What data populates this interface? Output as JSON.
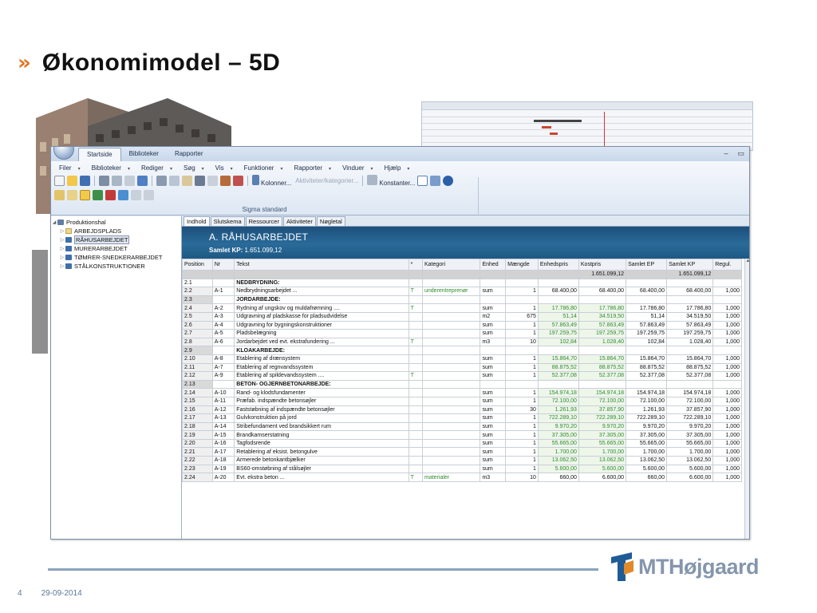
{
  "slide": {
    "title": "Økonomimodel – 5D",
    "page_number": "4",
    "date": "29-09-2014",
    "logo_text": "MTHøjgaard"
  },
  "window": {
    "tabs": [
      "Startside",
      "Biblioteker",
      "Rapporter"
    ],
    "active_tab": "Startside",
    "menu": [
      "Filer",
      "Biblioteker",
      "Rediger",
      "Søg",
      "Vis",
      "Funktioner",
      "Rapporter",
      "Vinduer",
      "Hjælp"
    ],
    "toolbar_labels": {
      "kolonner": "Kolonner...",
      "aktiviteter": "Aktiviteter/kategorier...",
      "konstanter": "Konstanter..."
    },
    "group_label": "Sigma standard"
  },
  "tree": {
    "root": "Produktionshal",
    "items": [
      "ARBEJDSPLADS",
      "RÅHUSARBEJDET",
      "MURERARBEJDET",
      "TØMRER-SNEDKERARBEJDET",
      "STÅLKONSTRUKTIONER"
    ],
    "selected": "RÅHUSARBEJDET"
  },
  "doc_tabs": [
    "Indhold",
    "Slutskema",
    "Ressourcer",
    "Aktiviteter",
    "Nøgletal"
  ],
  "banner": {
    "title": "A. RÅHUSARBEJDET",
    "samlet_label": "Samlet KP:",
    "samlet_value": "1.651.099,12"
  },
  "table": {
    "columns": [
      "Position",
      "Nr",
      "Tekst",
      "*",
      "Kategori",
      "Enhed",
      "Mængde",
      "Enhedspris",
      "Kostpris",
      "Samlet EP",
      "Samlet KP",
      "Regul."
    ],
    "totals": {
      "kostpris": "1.651.099,12",
      "samlet_kp": "1.651.099,12"
    },
    "rows": [
      {
        "pos": "2.1",
        "nr": "",
        "tekst": "NEDBRYDNING:",
        "star": "",
        "kat": "",
        "enhed": "",
        "maengde": "",
        "ep": "",
        "kp": "",
        "sep": "",
        "skp": "",
        "regul": "",
        "header": true
      },
      {
        "pos": "2.2",
        "nr": "A-1",
        "tekst": "Nedbrydningsarbejdet ...",
        "star": "T",
        "kat": "underentreprenør",
        "enhed": "sum",
        "maengde": "1",
        "ep": "68.400,00",
        "kp": "68.400,00",
        "sep": "68.400,00",
        "skp": "68.400,00",
        "regul": "1,000"
      },
      {
        "pos": "2.3",
        "nr": "",
        "tekst": "JORDARBEJDE:",
        "star": "",
        "kat": "",
        "enhed": "",
        "maengde": "",
        "ep": "",
        "kp": "",
        "sep": "",
        "skp": "",
        "regul": "",
        "header": true
      },
      {
        "pos": "2.4",
        "nr": "A-2",
        "tekst": "Rydning af ungskov og muldafrømning ....",
        "star": "T",
        "kat": "",
        "enhed": "sum",
        "maengde": "1",
        "ep": "17.786,80",
        "kp": "17.786,80",
        "sep": "17.786,80",
        "skp": "17.786,80",
        "regul": "1,000",
        "green": true
      },
      {
        "pos": "2.5",
        "nr": "A-3",
        "tekst": "Udgravning af pladskasse for pladsudvidelse",
        "star": "",
        "kat": "",
        "enhed": "m2",
        "maengde": "675",
        "ep": "51,14",
        "kp": "34.519,50",
        "sep": "51,14",
        "skp": "34.519,50",
        "regul": "1,000",
        "green": true
      },
      {
        "pos": "2.6",
        "nr": "A-4",
        "tekst": "Udgravning for bygningskonstruktioner",
        "star": "",
        "kat": "",
        "enhed": "sum",
        "maengde": "1",
        "ep": "57.863,49",
        "kp": "57.863,49",
        "sep": "57.863,49",
        "skp": "57.863,49",
        "regul": "1,000",
        "green": true
      },
      {
        "pos": "2.7",
        "nr": "A-5",
        "tekst": "Pladsbelægning",
        "star": "",
        "kat": "",
        "enhed": "sum",
        "maengde": "1",
        "ep": "197.259,75",
        "kp": "197.259,75",
        "sep": "197.259,75",
        "skp": "197.259,75",
        "regul": "1,000",
        "green": true
      },
      {
        "pos": "2.8",
        "nr": "A-6",
        "tekst": "Jordarbejdet ved evt. ekstrafundering ...",
        "star": "T",
        "kat": "",
        "enhed": "m3",
        "maengde": "10",
        "ep": "102,84",
        "kp": "1.028,40",
        "sep": "102,84",
        "skp": "1.028,40",
        "regul": "1,000",
        "green": true
      },
      {
        "pos": "2.9",
        "nr": "",
        "tekst": "KLOAKARBEJDE:",
        "star": "",
        "kat": "",
        "enhed": "",
        "maengde": "",
        "ep": "",
        "kp": "",
        "sep": "",
        "skp": "",
        "regul": "",
        "header": true
      },
      {
        "pos": "2.10",
        "nr": "A-8",
        "tekst": "Etablering af drænsystem",
        "star": "",
        "kat": "",
        "enhed": "sum",
        "maengde": "1",
        "ep": "15.864,70",
        "kp": "15.864,70",
        "sep": "15.864,70",
        "skp": "15.864,70",
        "regul": "1,000",
        "green": true
      },
      {
        "pos": "2.11",
        "nr": "A-7",
        "tekst": "Etablering af regnvandssystem",
        "star": "",
        "kat": "",
        "enhed": "sum",
        "maengde": "1",
        "ep": "88.875,52",
        "kp": "88.875,52",
        "sep": "88.875,52",
        "skp": "88.875,52",
        "regul": "1,000",
        "green": true
      },
      {
        "pos": "2.12",
        "nr": "A-9",
        "tekst": "Etablering af spildevandssystem ....",
        "star": "T",
        "kat": "",
        "enhed": "sum",
        "maengde": "1",
        "ep": "52.377,08",
        "kp": "52.377,08",
        "sep": "52.377,08",
        "skp": "52.377,08",
        "regul": "1,000",
        "green": true
      },
      {
        "pos": "2.13",
        "nr": "",
        "tekst": "BETON- OGJERNBETONARBEJDE:",
        "star": "",
        "kat": "",
        "enhed": "",
        "maengde": "",
        "ep": "",
        "kp": "",
        "sep": "",
        "skp": "",
        "regul": "",
        "header": true
      },
      {
        "pos": "2.14",
        "nr": "A-10",
        "tekst": "Rand- og klodsfundamenter",
        "star": "",
        "kat": "",
        "enhed": "sum",
        "maengde": "1",
        "ep": "154.974,18",
        "kp": "154.974,18",
        "sep": "154.974,18",
        "skp": "154.974,18",
        "regul": "1,000",
        "green": true
      },
      {
        "pos": "2.15",
        "nr": "A-11",
        "tekst": "Præfab. indspændte betonsøjler",
        "star": "",
        "kat": "",
        "enhed": "sum",
        "maengde": "1",
        "ep": "72.100,00",
        "kp": "72.100,00",
        "sep": "72.100,00",
        "skp": "72.100,00",
        "regul": "1,000",
        "green": true
      },
      {
        "pos": "2.16",
        "nr": "A-12",
        "tekst": "Faststøbning af indspændte betonsøjler",
        "star": "",
        "kat": "",
        "enhed": "sum",
        "maengde": "30",
        "ep": "1.261,93",
        "kp": "37.857,90",
        "sep": "1.261,93",
        "skp": "37.857,90",
        "regul": "1,000",
        "green": true
      },
      {
        "pos": "2.17",
        "nr": "A-13",
        "tekst": "Gulvkonstruktion på jord",
        "star": "",
        "kat": "",
        "enhed": "sum",
        "maengde": "1",
        "ep": "722.289,10",
        "kp": "722.289,10",
        "sep": "722.289,10",
        "skp": "722.289,10",
        "regul": "1,000",
        "green": true
      },
      {
        "pos": "2.18",
        "nr": "A-14",
        "tekst": "Stribefundament ved brandsikkert rum",
        "star": "",
        "kat": "",
        "enhed": "sum",
        "maengde": "1",
        "ep": "9.970,20",
        "kp": "9.970,20",
        "sep": "9.970,20",
        "skp": "9.970,20",
        "regul": "1,000",
        "green": true
      },
      {
        "pos": "2.19",
        "nr": "A-15",
        "tekst": "Brandkamserstatning",
        "star": "",
        "kat": "",
        "enhed": "sum",
        "maengde": "1",
        "ep": "37.305,00",
        "kp": "37.305,00",
        "sep": "37.305,00",
        "skp": "37.305,00",
        "regul": "1,000",
        "green": true
      },
      {
        "pos": "2.20",
        "nr": "A-16",
        "tekst": "Tagfodsrende",
        "star": "",
        "kat": "",
        "enhed": "sum",
        "maengde": "1",
        "ep": "55.665,00",
        "kp": "55.665,00",
        "sep": "55.665,00",
        "skp": "55.665,00",
        "regul": "1,000",
        "green": true
      },
      {
        "pos": "2.21",
        "nr": "A-17",
        "tekst": "Retablering af eksist. betongulve",
        "star": "",
        "kat": "",
        "enhed": "sum",
        "maengde": "1",
        "ep": "1.700,00",
        "kp": "1.700,00",
        "sep": "1.700,00",
        "skp": "1.700,00",
        "regul": "1,000",
        "green": true
      },
      {
        "pos": "2.22",
        "nr": "A-18",
        "tekst": "Armerede betonkantbjælker",
        "star": "",
        "kat": "",
        "enhed": "sum",
        "maengde": "1",
        "ep": "13.062,50",
        "kp": "13.062,50",
        "sep": "13.062,50",
        "skp": "13.062,50",
        "regul": "1,000",
        "green": true
      },
      {
        "pos": "2.23",
        "nr": "A-19",
        "tekst": "BS60-omstøbning af stålsøjler",
        "star": "",
        "kat": "",
        "enhed": "sum",
        "maengde": "1",
        "ep": "5.600,00",
        "kp": "5.600,00",
        "sep": "5.600,00",
        "skp": "5.600,00",
        "regul": "1,000",
        "green": true
      },
      {
        "pos": "2.24",
        "nr": "A-20",
        "tekst": "Evt. ekstra beton ...",
        "star": "T",
        "kat": "materialer",
        "enhed": "m3",
        "maengde": "10",
        "ep": "660,00",
        "kp": "6.600,00",
        "sep": "660,00",
        "skp": "6.600,00",
        "regul": "1,000"
      }
    ]
  },
  "colors": {
    "accent_orange": "#e0731f",
    "banner_blue": "#1d4f7c",
    "value_green": "#2e8b2e",
    "logo_grey": "#8496ad"
  }
}
